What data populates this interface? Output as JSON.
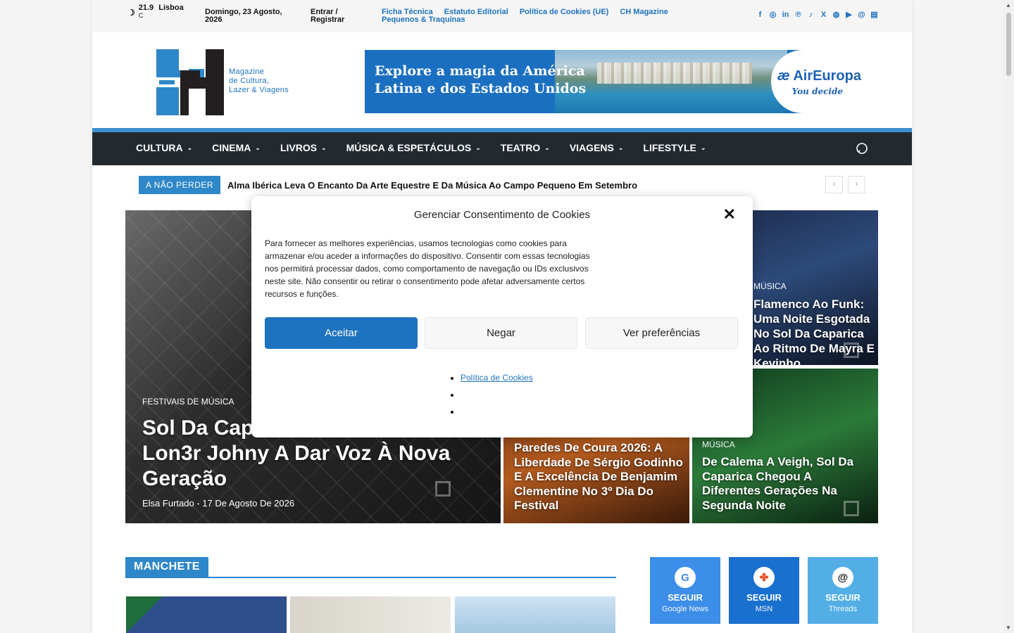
{
  "topbar": {
    "temperature": "21.9",
    "unit": "C",
    "city": "Lisboa",
    "date": "Domingo, 23 Agosto, 2026",
    "login": "Entrar / Registrar",
    "links": [
      "Ficha Técnica",
      "Estatuto Editorial",
      "Política de Cookies (UE)",
      "CH Magazine",
      "Pequenos & Traquinas"
    ],
    "social_icons": [
      "facebook-icon",
      "instagram-icon",
      "linkedin-icon",
      "pinterest-icon",
      "tiktok-icon",
      "x-icon",
      "web-icon",
      "youtube-icon",
      "threads-icon",
      "news-icon"
    ]
  },
  "logo": {
    "tagline_1": "Magazine",
    "tagline_2": "de Cultura,",
    "tagline_3": "Lazer & Viagens"
  },
  "banner": {
    "line_1": "Explore a magia da América",
    "line_2": "Latina e dos Estados Unidos",
    "brand": "AirEuropa",
    "slogan": "You decide"
  },
  "nav": {
    "items": [
      "CULTURA",
      "CINEMA",
      "LIVROS",
      "MÚSICA & ESPETÁCULOS",
      "TEATRO",
      "VIAGENS",
      "LIFESTYLE"
    ]
  },
  "ticker": {
    "label": "A NÃO PERDER",
    "text": "Alma Ibérica Leva O Encanto Da Arte Equestre E Da Música Ao Campo Pequeno Em Setembro"
  },
  "featured": {
    "main": {
      "category": "FESTIVAIS DE MÚSICA",
      "title": "Sol Da Caparica Com Slow J E Lon3r Johny A Dar Voz À Nova Geração",
      "author": "Elsa Furtado",
      "date": "17 De Agosto De 2026"
    },
    "top_right": {
      "category": "MÚSICA",
      "title": "Flamenco Ao Funk: Uma Noite Esgotada No Sol Da Caparica Ao Ritmo De Mayra E Kevinho"
    },
    "bottom_middle": {
      "title": "Paredes De Coura 2026: A Liberdade De Sérgio Godinho E A Excelência De Benjamim Clementine No 3º Dia Do Festival"
    },
    "bottom_right": {
      "category": "MÚSICA",
      "title": "De Calema A Veigh, Sol Da Caparica Chegou A Diferentes Gerações Na Segunda Noite"
    }
  },
  "section": {
    "title": "MANCHETE"
  },
  "follow": [
    {
      "label": "SEGUIR",
      "sub": "Google News",
      "icon": "google-icon"
    },
    {
      "label": "SEGUIR",
      "sub": "MSN",
      "icon": "msn-icon"
    },
    {
      "label": "SEGUIR",
      "sub": "Threads",
      "icon": "threads-icon"
    }
  ],
  "cookie_modal": {
    "title": "Gerenciar Consentimento de Cookies",
    "body": "Para fornecer as melhores experiências, usamos tecnologias como cookies para armazenar e/ou aceder a informações do dispositivo. Consentir com essas tecnologias nos permitirá processar dados, como comportamento de navegação ou IDs exclusivos neste site. Não consentir ou retirar o consentimento pode afetar adversamente certos recursos e funções.",
    "accept": "Aceitar",
    "deny": "Negar",
    "preferences": "Ver preferências",
    "policy_link": "Política de Cookies"
  },
  "colors": {
    "accent": "#1e73be",
    "nav_bg": "#222a30",
    "nav_border": "#3a8fd1"
  }
}
